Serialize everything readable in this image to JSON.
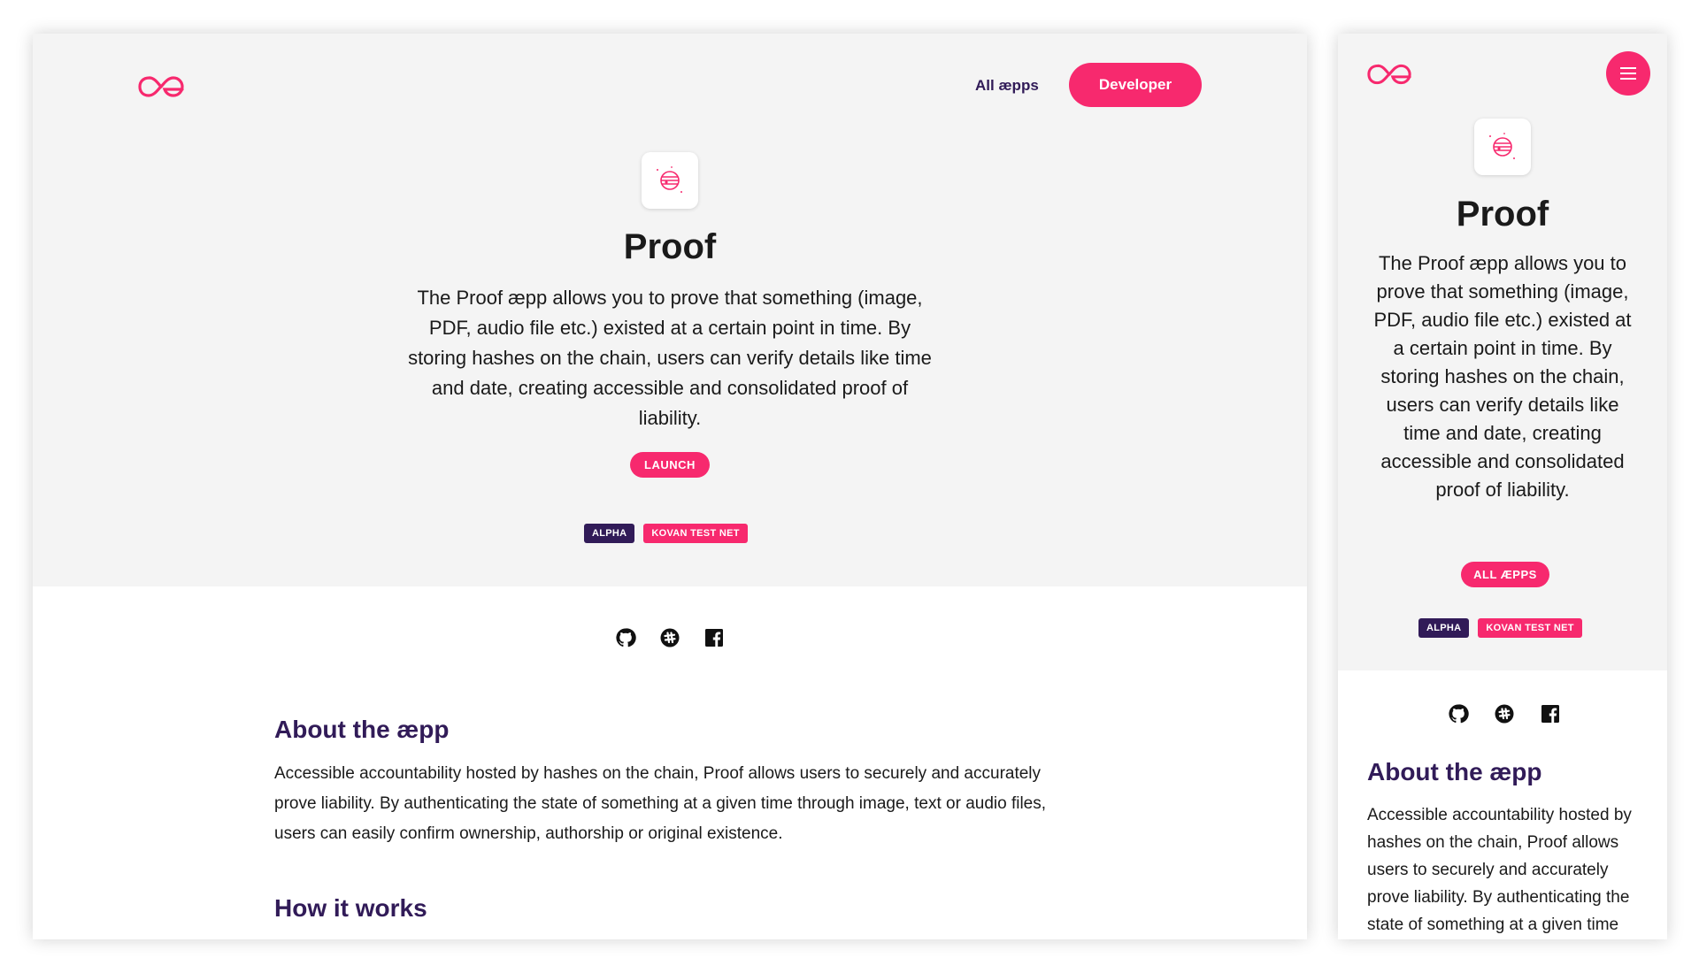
{
  "brand": {
    "accent": "#f7296e",
    "dark": "#311b58",
    "hero_bg": "#f4f4f4"
  },
  "desktop": {
    "nav": {
      "all_aepps": "All æpps",
      "developer": "Developer"
    },
    "app": {
      "icon": "globe-icon",
      "title": "Proof",
      "description": "The Proof æpp allows you to prove that something (image, PDF, audio file etc.) existed at a certain point in time. By storing hashes on the chain, users can verify details like time and date, creating accessible and consolidated proof of liability.",
      "launch_label": "LAUNCH",
      "badges": [
        "ALPHA",
        "KOVAN TEST NET"
      ]
    },
    "social": [
      "github-icon",
      "slack-icon",
      "facebook-icon"
    ],
    "about": {
      "heading": "About the æpp",
      "text": "Accessible accountability hosted by hashes on the chain, Proof allows users to securely and accurately prove liability. By authenticating the state of something at a given time through image, text or audio files, users can easily confirm ownership, authorship or original existence."
    },
    "how": {
      "heading": "How it works"
    }
  },
  "mobile": {
    "app": {
      "title": "Proof",
      "description": "The Proof æpp allows you to prove that something (image, PDF, audio file etc.) existed at a certain point in time. By storing hashes on the chain, users can verify details like time and date, creating accessible and consolidated proof of liability.",
      "all_aepps_label": "ALL ÆPPS",
      "badges": [
        "ALPHA",
        "KOVAN TEST NET"
      ]
    },
    "about": {
      "heading": "About the æpp",
      "text": "Accessible accountability hosted by hashes on the chain, Proof allows users to securely and accurately prove liability. By authenticating the state of something at a given time"
    }
  }
}
